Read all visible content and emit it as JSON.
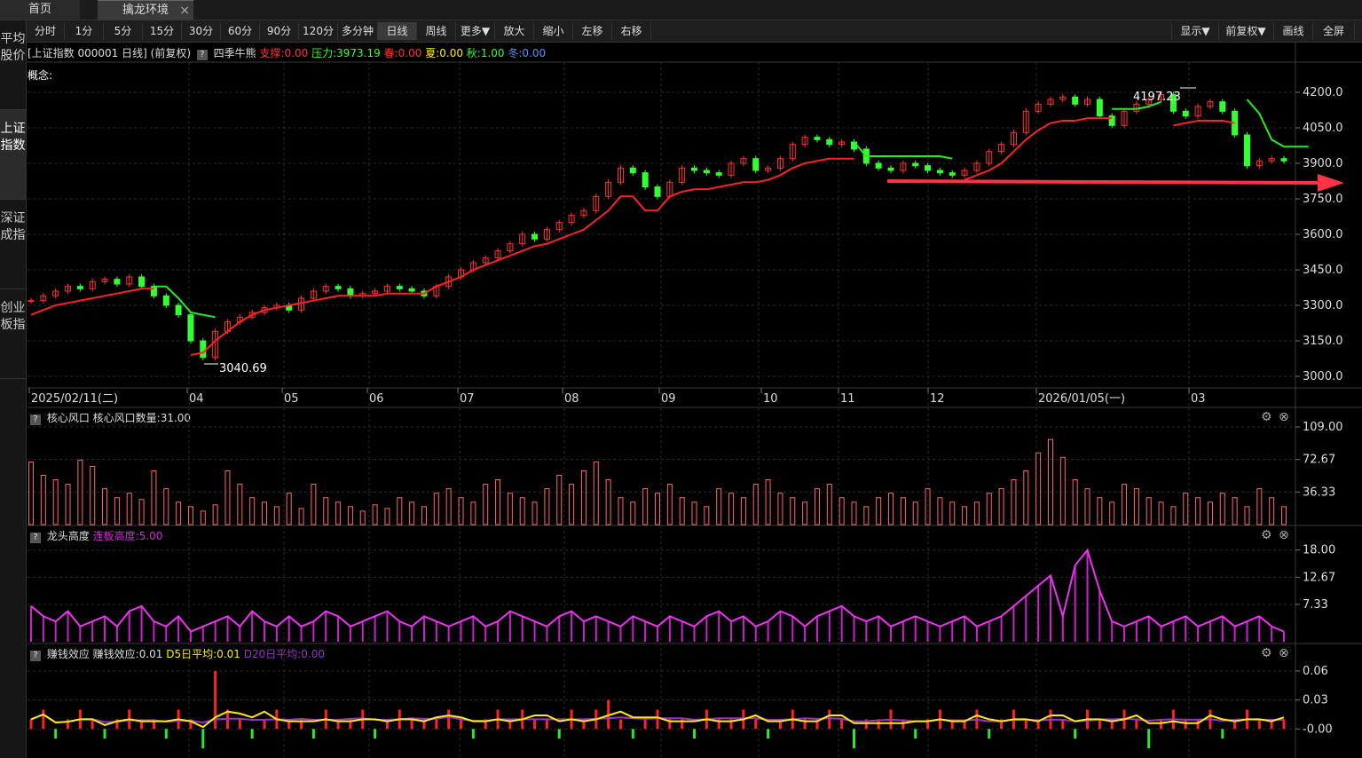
{
  "tabs": {
    "home": "首页",
    "env": "擒龙环境",
    "close": "×"
  },
  "toolbar": {
    "periods": [
      "分时",
      "1分",
      "5分",
      "15分",
      "30分",
      "60分",
      "90分",
      "120分",
      "多分钟",
      "日线",
      "周线",
      "更多▼"
    ],
    "active": "日线",
    "actions": [
      "放大",
      "缩小",
      "左移",
      "右移"
    ],
    "right": [
      "显示▼",
      "前复权▼",
      "画线",
      "全屏"
    ]
  },
  "sidebar": [
    "平均股价",
    "上证指数",
    "深证成指",
    "创业板指"
  ],
  "sidebar_active": 1,
  "main": {
    "title": "[上证指数 000001 日线]",
    "adj": "(前复权)",
    "q": "?",
    "indicator": "四季牛熊",
    "support": "支撑:0.00",
    "resist": "压力:3973.19",
    "spring": "春:0.00",
    "summer": "夏:0.00",
    "autumn": "秋:1.00",
    "winter": "冬:0.00",
    "concept": "概念:",
    "high_label": "4197.23",
    "low_label": "3040.69"
  },
  "chart_data": [
    {
      "type": "candlestick",
      "yticks": [
        4200.0,
        4050.0,
        3900.0,
        3750.0,
        3600.0,
        3450.0,
        3300.0,
        3150.0,
        3000.0
      ],
      "ytick_labels": [
        "4200.0",
        "4050.0",
        "3900.0",
        "3750.0",
        "3600.0",
        "3450.0",
        "3300.0",
        "3150.0",
        "3000.0"
      ],
      "xlabels": [
        "2025/02/11(二)",
        "04",
        "05",
        "06",
        "07",
        "08",
        "09",
        "10",
        "11",
        "12",
        "2026/01/05(一)",
        "03"
      ],
      "ylim": [
        2970,
        4260
      ],
      "high": 4197.23,
      "low": 3040.69,
      "close": [
        3320,
        3340,
        3360,
        3380,
        3370,
        3400,
        3410,
        3390,
        3420,
        3380,
        3340,
        3300,
        3260,
        3150,
        3080,
        3190,
        3230,
        3250,
        3270,
        3290,
        3300,
        3280,
        3330,
        3360,
        3380,
        3370,
        3340,
        3350,
        3360,
        3380,
        3370,
        3360,
        3340,
        3380,
        3420,
        3450,
        3480,
        3500,
        3530,
        3560,
        3600,
        3580,
        3620,
        3650,
        3680,
        3700,
        3760,
        3820,
        3880,
        3860,
        3800,
        3760,
        3820,
        3880,
        3870,
        3860,
        3850,
        3900,
        3920,
        3870,
        3880,
        3920,
        3980,
        4010,
        4000,
        3980,
        3990,
        3960,
        3900,
        3880,
        3870,
        3900,
        3890,
        3870,
        3860,
        3850,
        3870,
        3900,
        3950,
        3980,
        4030,
        4120,
        4150,
        4170,
        4180,
        4150,
        4170,
        4100,
        4060,
        4120,
        4150,
        4170,
        4190,
        4120,
        4100,
        4140,
        4160,
        4120,
        4020,
        3890,
        3910,
        3920,
        3910
      ],
      "support_line": [
        3260,
        3280,
        3300,
        3310,
        3320,
        3330,
        3340,
        3350,
        3360,
        3370,
        3370,
        null,
        null,
        3090,
        3100,
        3150,
        3190,
        3230,
        3260,
        3280,
        3290,
        3300,
        3310,
        3320,
        3330,
        3340,
        3340,
        3340,
        3340,
        3350,
        3350,
        3350,
        3350,
        3380,
        3400,
        3420,
        3450,
        3470,
        3490,
        3510,
        3530,
        3550,
        3560,
        3580,
        3600,
        3620,
        3660,
        3700,
        3760,
        3760,
        3700,
        3700,
        3760,
        3780,
        3790,
        3790,
        3800,
        3810,
        3820,
        3820,
        3830,
        3850,
        3880,
        3900,
        3910,
        3920,
        3920,
        3920,
        null,
        null,
        null,
        null,
        null,
        null,
        null,
        null,
        3830,
        3850,
        3870,
        3900,
        3950,
        4000,
        4040,
        4070,
        4080,
        4080,
        4090,
        4090,
        4090,
        null,
        null,
        null,
        null,
        4060,
        4070,
        4080,
        4080,
        4080,
        4070,
        null,
        null,
        null,
        null
      ],
      "pressure_line": [
        null,
        null,
        null,
        null,
        null,
        null,
        null,
        null,
        null,
        null,
        3380,
        3380,
        3330,
        3270,
        3260,
        3250,
        null,
        null,
        null,
        null,
        null,
        null,
        null,
        null,
        null,
        null,
        null,
        null,
        null,
        null,
        null,
        null,
        null,
        null,
        null,
        null,
        null,
        null,
        null,
        null,
        null,
        null,
        null,
        null,
        null,
        null,
        null,
        null,
        null,
        null,
        null,
        null,
        null,
        null,
        null,
        null,
        null,
        null,
        null,
        null,
        null,
        null,
        null,
        null,
        null,
        null,
        null,
        3990,
        3930,
        3930,
        3930,
        3930,
        3930,
        3930,
        3930,
        3920,
        null,
        null,
        null,
        null,
        null,
        null,
        null,
        null,
        null,
        null,
        null,
        null,
        4130,
        4130,
        4130,
        4140,
        4160,
        null,
        null,
        null,
        null,
        null,
        null,
        4170,
        4110,
        4000,
        3970,
        3970,
        3970
      ]
    },
    {
      "type": "bar",
      "title": "核心风口",
      "yticks": [
        109.0,
        72.67,
        36.33
      ],
      "ytick_labels": [
        "109.00",
        "72.67",
        "36.33"
      ],
      "ylim": [
        0,
        112
      ],
      "values": [
        70,
        55,
        50,
        45,
        72,
        65,
        40,
        30,
        35,
        28,
        60,
        40,
        25,
        20,
        15,
        22,
        60,
        45,
        30,
        25,
        20,
        35,
        18,
        45,
        30,
        25,
        20,
        15,
        22,
        18,
        30,
        25,
        20,
        35,
        40,
        30,
        25,
        45,
        50,
        35,
        30,
        25,
        40,
        55,
        45,
        60,
        70,
        50,
        30,
        25,
        40,
        35,
        45,
        30,
        25,
        20,
        40,
        35,
        30,
        45,
        50,
        35,
        30,
        25,
        40,
        45,
        30,
        25,
        20,
        30,
        35,
        30,
        25,
        40,
        30,
        25,
        20,
        25,
        35,
        40,
        50,
        60,
        80,
        95,
        75,
        50,
        40,
        30,
        25,
        45,
        40,
        30,
        25,
        20,
        35,
        30,
        25,
        35,
        30,
        20,
        40,
        30,
        20
      ]
    },
    {
      "type": "area",
      "title": "龙头高度",
      "yticks": [
        18.0,
        12.67,
        7.33
      ],
      "ytick_labels": [
        "18.00",
        "12.67",
        "7.33"
      ],
      "ylim": [
        0,
        19
      ],
      "values": [
        7,
        5,
        4,
        6,
        3,
        4,
        5,
        3,
        6,
        7,
        4,
        3,
        5,
        2,
        3,
        4,
        5,
        3,
        6,
        4,
        3,
        5,
        3,
        4,
        6,
        5,
        3,
        4,
        5,
        6,
        4,
        3,
        5,
        4,
        3,
        4,
        5,
        3,
        4,
        6,
        5,
        4,
        3,
        5,
        6,
        4,
        5,
        4,
        3,
        5,
        4,
        3,
        5,
        4,
        3,
        5,
        6,
        4,
        5,
        3,
        4,
        6,
        5,
        3,
        5,
        6,
        7,
        5,
        4,
        5,
        3,
        4,
        5,
        4,
        3,
        4,
        5,
        3,
        4,
        5,
        7,
        9,
        11,
        13,
        5,
        15,
        18,
        10,
        4,
        3,
        4,
        5,
        3,
        4,
        5,
        3,
        4,
        5,
        3,
        4,
        5,
        3,
        2
      ]
    },
    {
      "type": "bar+line",
      "title": "赚钱效应",
      "yticks": [
        0.06,
        0.03,
        0.0
      ],
      "ytick_labels": [
        "0.06",
        "0.03",
        "-0.00"
      ],
      "ylim": [
        -0.03,
        0.07
      ],
      "values": [
        0.01,
        0.02,
        -0.01,
        0.01,
        0.02,
        0.01,
        -0.01,
        0.01,
        0.02,
        0.01,
        0.01,
        -0.01,
        0.02,
        0.01,
        -0.02,
        0.06,
        0.02,
        0.01,
        -0.01,
        0.01,
        0.02,
        0.01,
        0.01,
        -0.01,
        0.02,
        0.01,
        0.01,
        0.02,
        -0.01,
        0.01,
        0.02,
        0.01,
        0.01,
        0.01,
        0.02,
        0.01,
        -0.01,
        0.01,
        0.02,
        0.01,
        0.02,
        0.01,
        0.01,
        -0.01,
        0.02,
        0.01,
        0.02,
        0.03,
        0.01,
        -0.01,
        0.01,
        0.02,
        0.01,
        0.01,
        -0.01,
        0.02,
        0.01,
        0.01,
        0.02,
        0.01,
        -0.01,
        0.01,
        0.02,
        0.01,
        0.01,
        0.02,
        0.01,
        -0.02,
        0.01,
        0.01,
        0.02,
        0.01,
        -0.01,
        0.01,
        0.02,
        0.01,
        0.01,
        0.02,
        -0.01,
        0.01,
        0.02,
        0.01,
        0.01,
        0.02,
        0.01,
        -0.01,
        0.02,
        0.01,
        0.01,
        0.02,
        0.01,
        -0.02,
        0.01,
        0.02,
        0.01,
        0.01,
        0.02,
        -0.01,
        0.01,
        0.02,
        0.01,
        0.01,
        0.01
      ]
    }
  ],
  "panels": {
    "p1": {
      "q": "?",
      "name": "核心风口",
      "value": "核心风口数量:31.00"
    },
    "p2": {
      "q": "?",
      "name": "龙头高度",
      "value": "连板高度:5.00"
    },
    "p3": {
      "q": "?",
      "name": "赚钱效应",
      "value": "赚钱效应:0.01",
      "d5": "D5日平均:0.01",
      "d20": "D20日平均:0.00"
    }
  },
  "icons": {
    "gear": "gear-icon",
    "close": "close-icon"
  },
  "colors": {
    "up": "#ff3333",
    "down": "#33ff33",
    "accent_arrow": "#ff3344",
    "magenta": "#dd22dd",
    "yellow": "#ffee00",
    "purple": "#9933cc"
  }
}
